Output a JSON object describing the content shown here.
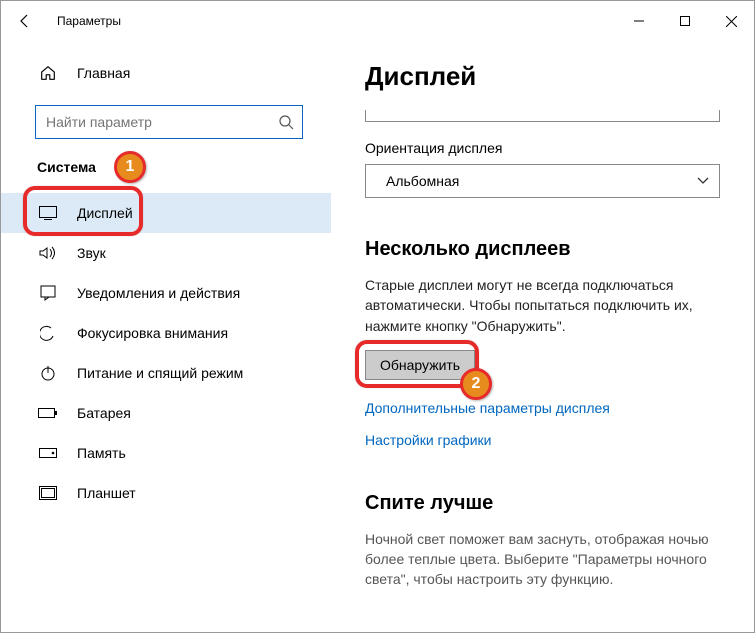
{
  "titlebar": {
    "title": "Параметры"
  },
  "sidebar": {
    "home": "Главная",
    "search_placeholder": "Найти параметр",
    "group": "Система",
    "items": [
      {
        "label": "Дисплей"
      },
      {
        "label": "Звук"
      },
      {
        "label": "Уведомления и действия"
      },
      {
        "label": "Фокусировка внимания"
      },
      {
        "label": "Питание и спящий режим"
      },
      {
        "label": "Батарея"
      },
      {
        "label": "Память"
      },
      {
        "label": "Планшет"
      }
    ]
  },
  "main": {
    "title": "Дисплей",
    "orientation_label": "Ориентация дисплея",
    "orientation_value": "Альбомная",
    "multi_title": "Несколько дисплеев",
    "multi_text": "Старые дисплеи могут не всегда подключаться автоматически. Чтобы попытаться подключить их, нажмите кнопку \"Обнаружить\".",
    "detect_btn": "Обнаружить",
    "link_adv": "Дополнительные параметры дисплея",
    "link_gfx": "Настройки графики",
    "sleep_title": "Спите лучше",
    "sleep_text": "Ночной свет поможет вам заснуть, отображая ночью более теплые цвета. Выберите \"Параметры ночного света\", чтобы настроить эту функцию."
  },
  "annotations": {
    "n1": "1",
    "n2": "2"
  }
}
